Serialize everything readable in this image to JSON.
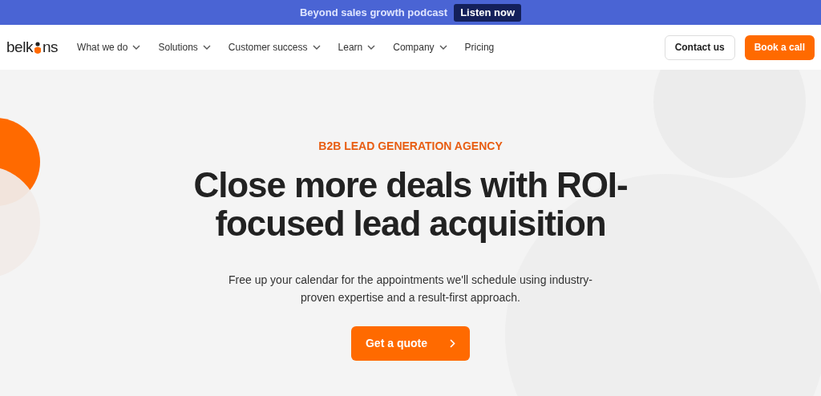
{
  "announcement": {
    "text": "Beyond sales growth podcast",
    "button": "Listen now"
  },
  "logo": {
    "before": "belk",
    "after": "ns"
  },
  "nav": [
    {
      "label": "What we do",
      "dropdown": true
    },
    {
      "label": "Solutions",
      "dropdown": true
    },
    {
      "label": "Customer success",
      "dropdown": true
    },
    {
      "label": "Learn",
      "dropdown": true
    },
    {
      "label": "Company",
      "dropdown": true
    },
    {
      "label": "Pricing",
      "dropdown": false
    }
  ],
  "header_buttons": [
    {
      "label": "Contact us",
      "kind": "outline"
    },
    {
      "label": "Book a call",
      "kind": "primary"
    }
  ],
  "hero": {
    "eyebrow": "B2B LEAD GENERATION AGENCY",
    "headline": [
      "Close more deals with ROI-",
      "focused lead acquisition"
    ],
    "subtitle": [
      "Free up your calendar for the appointments we'll schedule using industry-",
      "proven expertise and a result-first approach."
    ],
    "cta": "Get a quote"
  }
}
